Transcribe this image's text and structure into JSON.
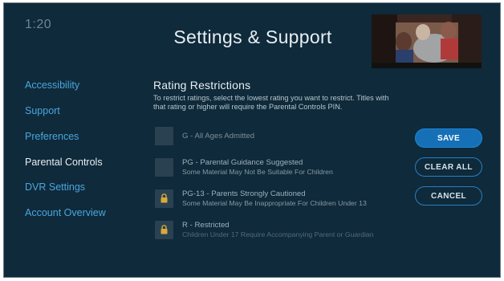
{
  "header": {
    "clock": "1:20",
    "title": "Settings & Support"
  },
  "sidebar": {
    "items": [
      {
        "label": "Accessibility",
        "active": false
      },
      {
        "label": "Support",
        "active": false
      },
      {
        "label": "Preferences",
        "active": false
      },
      {
        "label": "Parental Controls",
        "active": true
      },
      {
        "label": "DVR Settings",
        "active": false
      },
      {
        "label": "Account Overview",
        "active": false
      }
    ]
  },
  "main": {
    "section_title": "Rating Restrictions",
    "description": "To restrict ratings, select the lowest rating you want to restrict. Titles with that rating or higher will require the Parental Controls PIN.",
    "ratings": [
      {
        "title": "G - All Ages Admitted",
        "subtitle": "",
        "locked": false
      },
      {
        "title": "PG - Parental Guidance Suggested",
        "subtitle": "Some Material May Not Be Suitable For Children",
        "locked": false
      },
      {
        "title": "PG-13 - Parents Strongly Cautioned",
        "subtitle": "Some Material May Be Inappropriate For Children Under 13",
        "locked": true
      },
      {
        "title": "R - Restricted",
        "subtitle": "Children Under 17 Require Accompanying Parent or Guardian",
        "locked": true
      }
    ]
  },
  "actions": {
    "save": "SAVE",
    "clear_all": "CLEAR ALL",
    "cancel": "CANCEL"
  },
  "icons": {
    "lock": "lock-icon"
  },
  "colors": {
    "background": "#0f2a3a",
    "accent": "#1570b8",
    "nav_link": "#4aa6e0",
    "lock": "#d9a93a"
  }
}
